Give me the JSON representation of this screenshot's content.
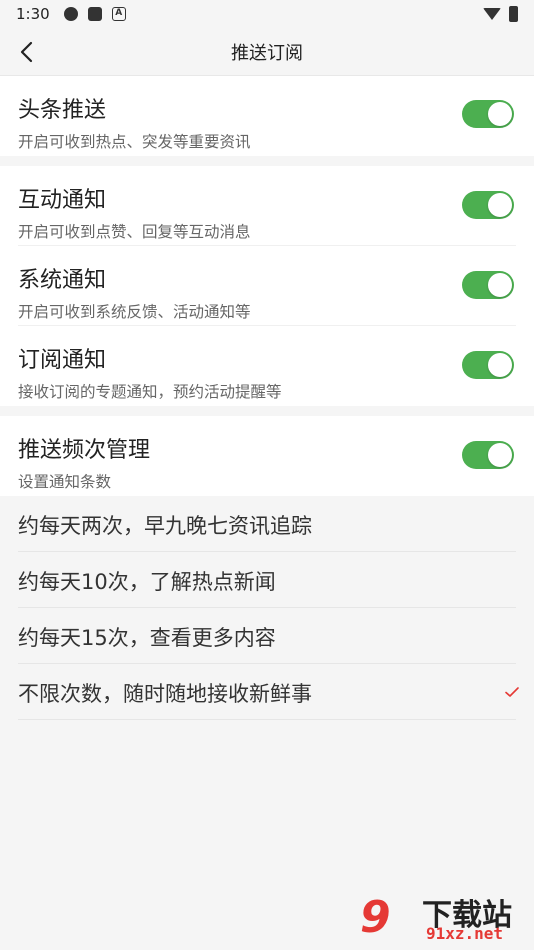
{
  "status_bar": {
    "time": "1:30"
  },
  "nav": {
    "title": "推送订阅"
  },
  "sections": {
    "headline": {
      "label": "头条推送",
      "desc": "开启可收到热点、突发等重要资讯",
      "enabled": true
    },
    "notifications": [
      {
        "label": "互动通知",
        "desc": "开启可收到点赞、回复等互动消息",
        "enabled": true
      },
      {
        "label": "系统通知",
        "desc": "开启可收到系统反馈、活动通知等",
        "enabled": true
      },
      {
        "label": "订阅通知",
        "desc": "接收订阅的专题通知，预约活动提醒等",
        "enabled": true
      }
    ],
    "frequency": {
      "label": "推送频次管理",
      "desc": "设置通知条数",
      "enabled": true,
      "options": [
        {
          "text": "约每天两次，早九晚七资讯追踪",
          "selected": false
        },
        {
          "text": "约每天10次，了解热点新闻",
          "selected": false
        },
        {
          "text": "约每天15次，查看更多内容",
          "selected": false
        },
        {
          "text": "不限次数，随时随地接收新鲜事",
          "selected": true
        }
      ]
    }
  },
  "colors": {
    "toggle_on": "#4caf50",
    "check": "#e53935"
  },
  "watermark": {
    "big": "下载站",
    "small": "91xz.net",
    "num": "9"
  }
}
